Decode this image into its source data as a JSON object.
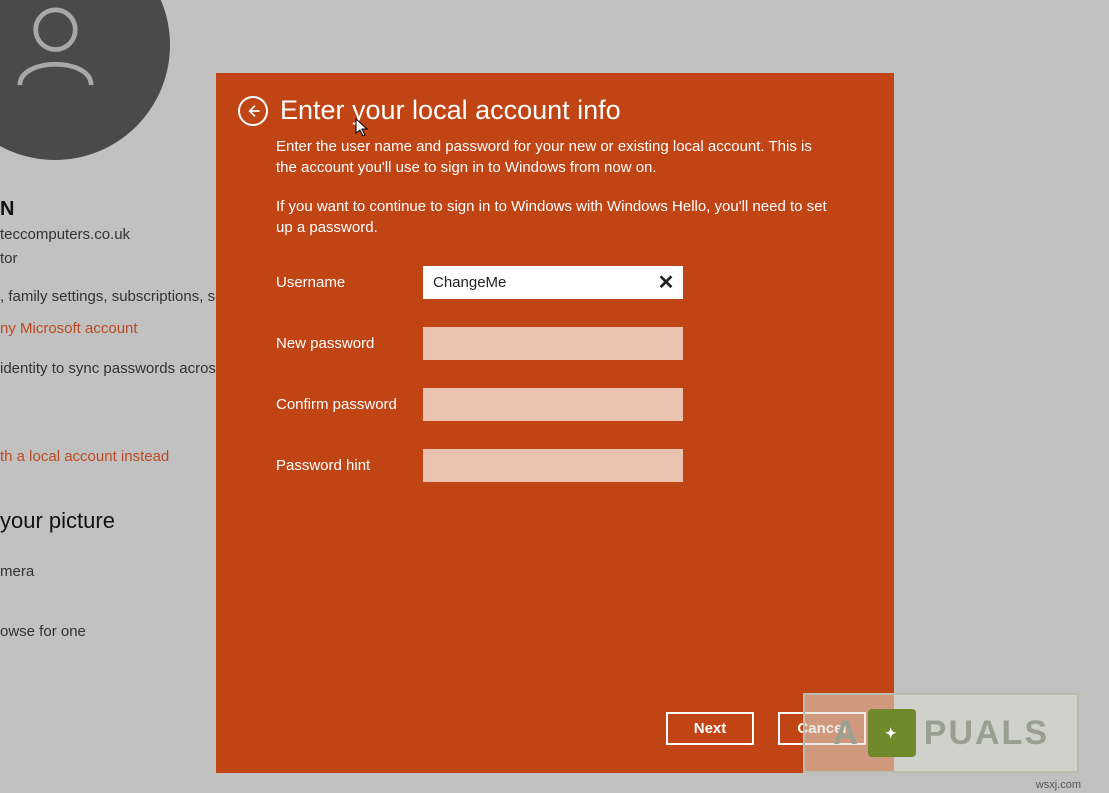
{
  "background": {
    "name_suffix": "N",
    "email_fragment": "teccomputers.co.uk",
    "role_fragment": "tor",
    "info_line1": ", family settings, subscriptions, sec",
    "link1": "ny Microsoft account",
    "info_line2": "identity to sync passwords across",
    "link2": "th a local account instead",
    "picture_heading": "your picture",
    "camera": "mera",
    "browse": "owse for one"
  },
  "modal": {
    "title": "Enter your local account info",
    "desc1": "Enter the user name and password for your new or existing local account. This is the account you'll use to sign in to Windows from now on.",
    "desc2": "If you want to continue to sign in to Windows with Windows Hello, you'll need to set up a password.",
    "fields": {
      "username_label": "Username",
      "username_value": "ChangeMe",
      "newpassword_label": "New password",
      "newpassword_value": "",
      "confirmpassword_label": "Confirm password",
      "confirmpassword_value": "",
      "passwordhint_label": "Password hint",
      "passwordhint_value": ""
    },
    "buttons": {
      "next": "Next",
      "cancel": "Cancel"
    }
  },
  "watermark": {
    "text_before": "A",
    "text_after": "PUALS",
    "credit": "wsxj.com"
  },
  "colors": {
    "modal_bg": "#c14415",
    "page_bg": "#c1c1c1"
  }
}
